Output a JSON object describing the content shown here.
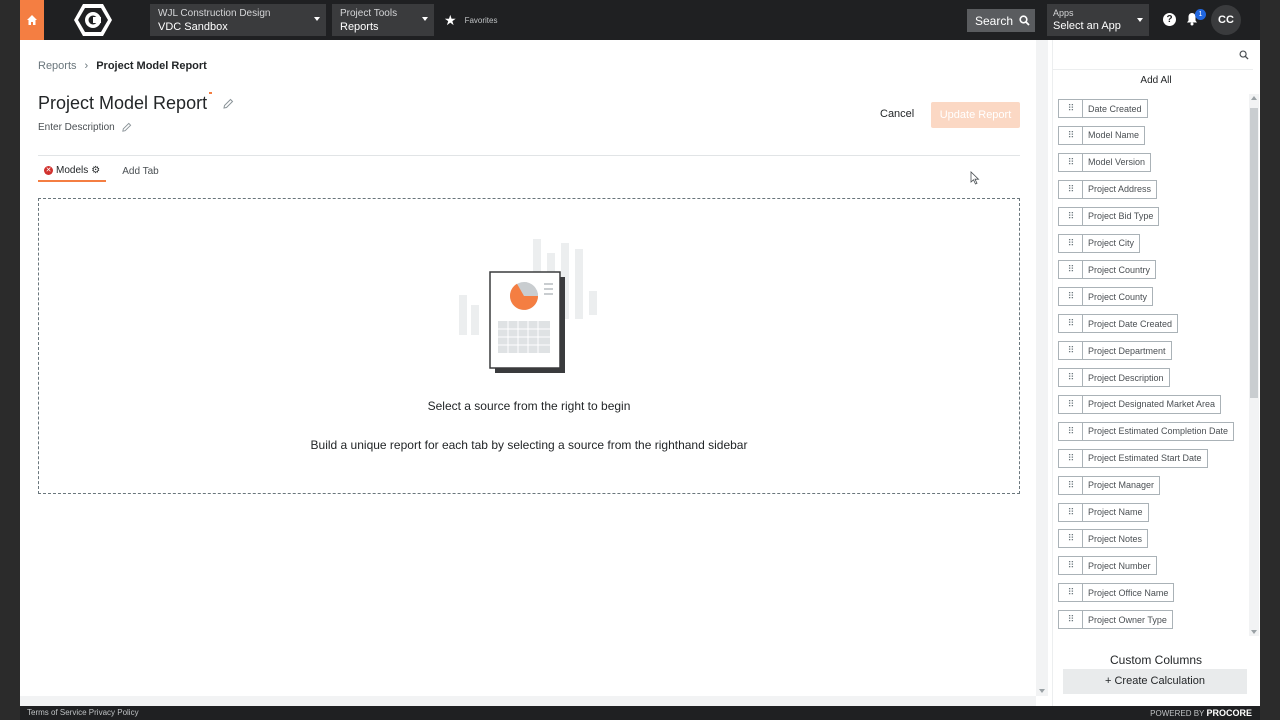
{
  "topbar": {
    "company_label": "WJL Construction Design",
    "project_name": "VDC Sandbox",
    "tool_label": "Project Tools",
    "tool_name": "Reports",
    "favorites_label": "Favorites",
    "search_label": "Search",
    "apps_label": "Apps",
    "apps_value": "Select an App",
    "help_label": "?",
    "notification_count": "1",
    "avatar_initials": "CC"
  },
  "breadcrumb": {
    "parent": "Reports",
    "current": "Project Model Report"
  },
  "header": {
    "title": "Project Model Report",
    "description_placeholder": "Enter Description",
    "cancel_label": "Cancel",
    "update_label": "Update Report"
  },
  "tabs": {
    "active": "Models",
    "add": "Add Tab"
  },
  "dropzone": {
    "prompt_primary": "Select a source from the right to begin",
    "prompt_secondary": "Build a unique report for each tab by selecting a source from the righthand sidebar"
  },
  "sidebar": {
    "add_all_label": "Add All",
    "items": [
      "Date Created",
      "Model Name",
      "Model Version",
      "Project Address",
      "Project Bid Type",
      "Project City",
      "Project Country",
      "Project County",
      "Project Date Created",
      "Project Department",
      "Project Description",
      "Project Designated Market Area",
      "Project Estimated Completion Date",
      "Project Estimated Start Date",
      "Project Manager",
      "Project Name",
      "Project Notes",
      "Project Number",
      "Project Office Name",
      "Project Owner Type"
    ],
    "custom_columns_title": "Custom Columns",
    "create_calculation_label": "+ Create Calculation"
  },
  "footer": {
    "links": "Terms of Service  Privacy Policy",
    "powered_by": "POWERED BY",
    "brand": "PROCORE"
  },
  "colors": {
    "accent": "#f47e42",
    "topbar": "#1f2022",
    "update_disabled": "#fbd8c4"
  }
}
